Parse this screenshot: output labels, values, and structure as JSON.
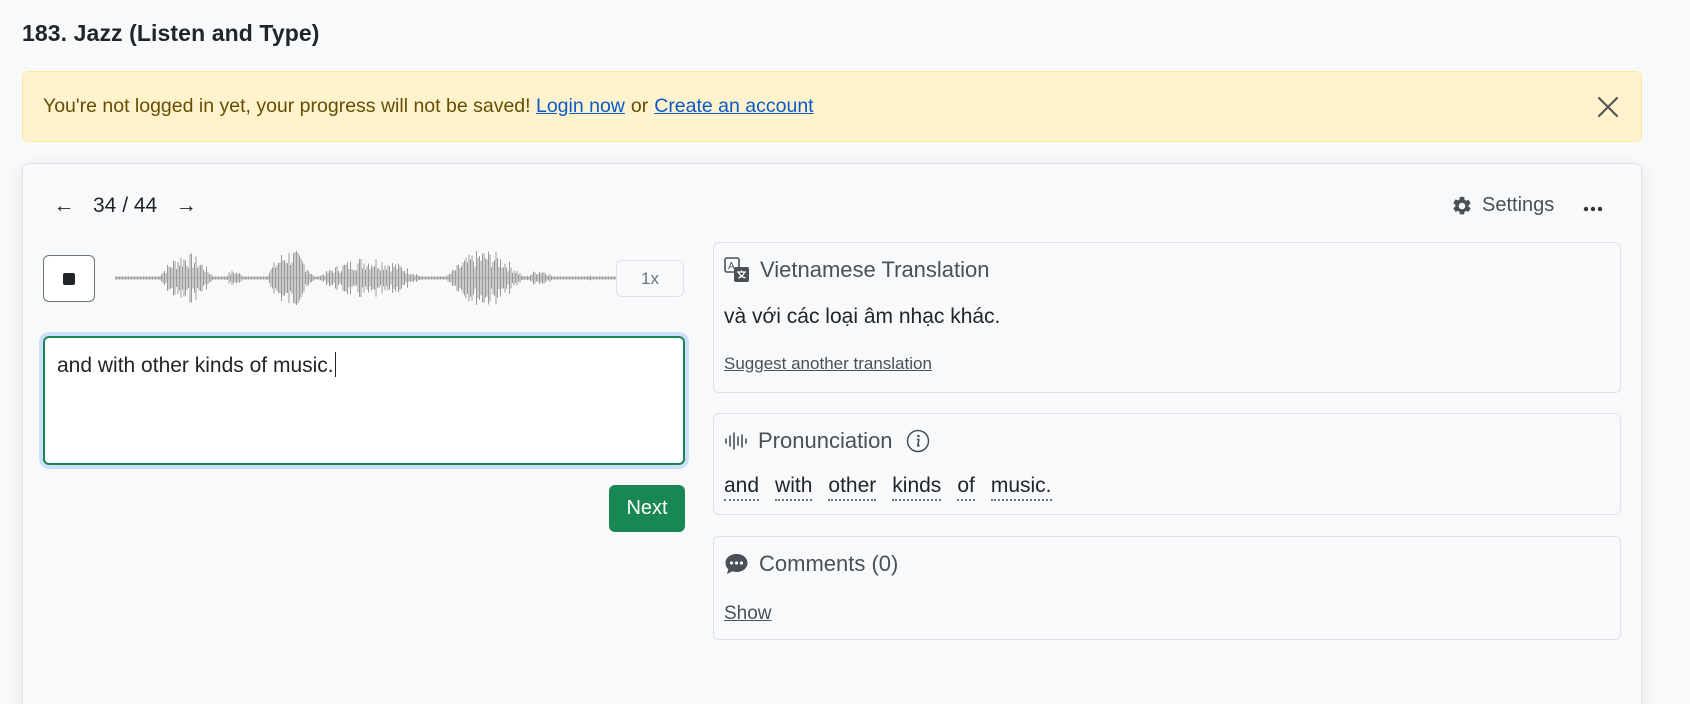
{
  "page": {
    "title": "183. Jazz (Listen and Type)"
  },
  "alert": {
    "message": "You're not logged in yet, your progress will not be saved!",
    "login_label": "Login now",
    "separator": "or",
    "create_label": "Create an account"
  },
  "player": {
    "prev_arrow": "←",
    "next_arrow": "→",
    "counter": "34 / 44",
    "settings_label": "Settings",
    "speed_label": "1x"
  },
  "answer": {
    "value": "and with other kinds of music."
  },
  "next_button_label": "Next",
  "translation": {
    "heading": "Vietnamese Translation",
    "text": "và với các loại âm nhạc khác.",
    "suggest_label": "Suggest another translation"
  },
  "pronunciation": {
    "heading": "Pronunciation",
    "words": [
      "and",
      "with",
      "other",
      "kinds",
      "of",
      "music."
    ]
  },
  "comments": {
    "heading": "Comments (0)",
    "show_label": "Show"
  },
  "icons": {
    "close": "close-icon",
    "gear": "gear-icon",
    "more": "more-horizontal-icon",
    "stop": "stop-icon",
    "translate": "translate-icon",
    "audio": "audio-waves-icon",
    "info": "info-icon",
    "chat": "chat-icon"
  },
  "colors": {
    "alert_bg": "#fff3cd",
    "link": "#0a58ca",
    "success": "#198754",
    "muted": "#495057",
    "waveform": "#9a9a9a"
  }
}
